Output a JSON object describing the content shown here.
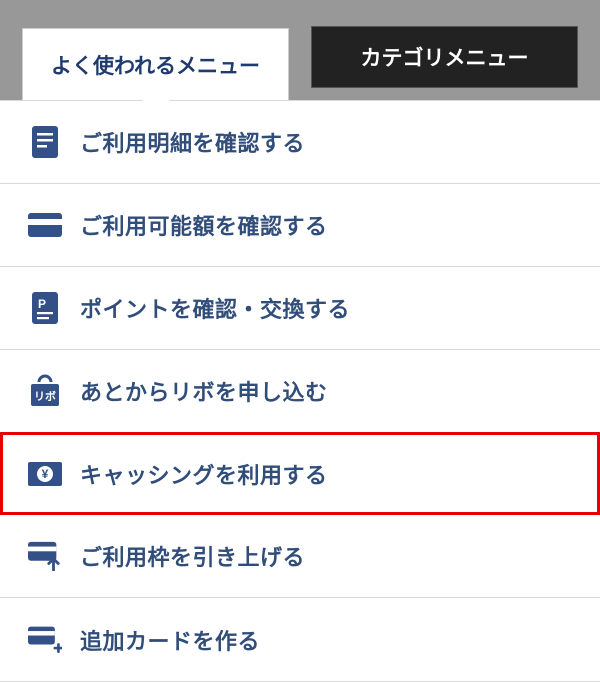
{
  "tabs": {
    "active": {
      "label": "よく使われるメニュー"
    },
    "inactive": {
      "label": "カテゴリメニュー"
    }
  },
  "menu": [
    {
      "icon": "statement-icon",
      "label": "ご利用明細を確認する",
      "highlight": false
    },
    {
      "icon": "card-icon",
      "label": "ご利用可能額を確認する",
      "highlight": false
    },
    {
      "icon": "points-icon",
      "label": "ポイントを確認・交換する",
      "highlight": false
    },
    {
      "icon": "revo-bag-icon",
      "label": "あとからリボを申し込む",
      "highlight": false
    },
    {
      "icon": "yen-card-icon",
      "label": "キャッシングを利用する",
      "highlight": true
    },
    {
      "icon": "limit-up-icon",
      "label": "ご利用枠を引き上げる",
      "highlight": false
    },
    {
      "icon": "add-card-icon",
      "label": "追加カードを作る",
      "highlight": false
    }
  ],
  "colors": {
    "brand": "#335186",
    "highlight": "#e60000"
  }
}
